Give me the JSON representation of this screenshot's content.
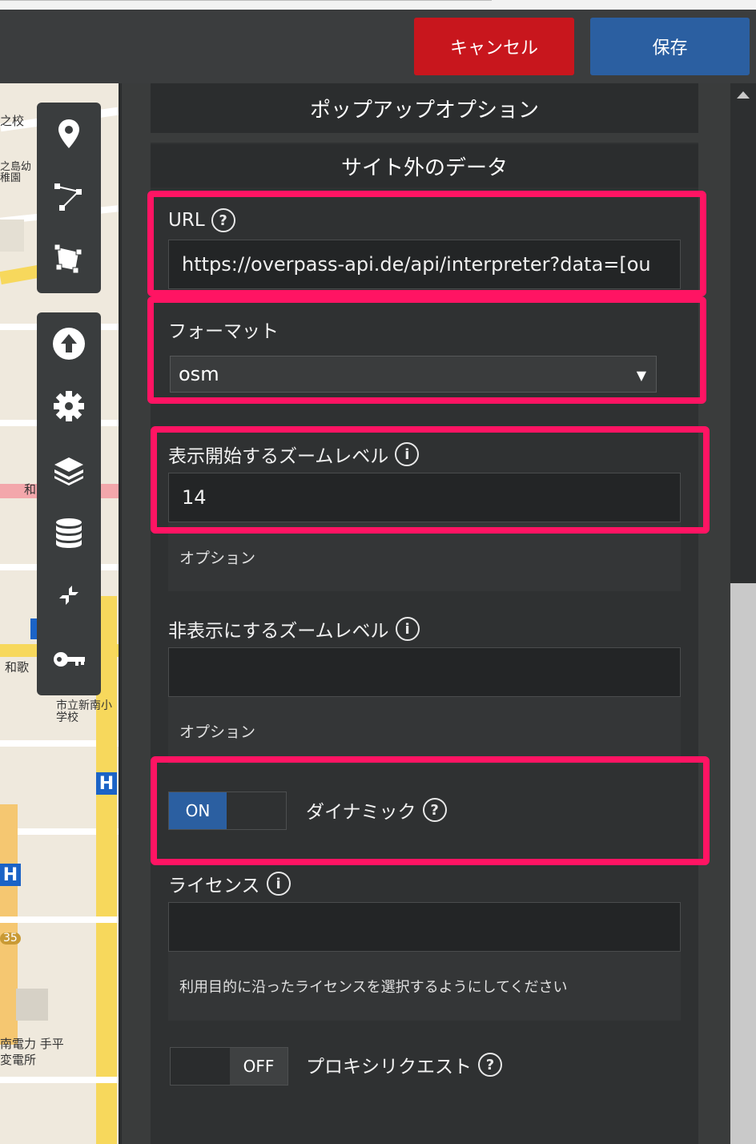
{
  "header": {
    "cancel_label": "キャンセル",
    "save_label": "保存"
  },
  "map": {
    "labels": [
      "之校",
      "之島幼稚園",
      "和",
      "和歌",
      "市立新南小学校",
      "35",
      "南電力 手平",
      "変電所"
    ],
    "hospital_marker": "H"
  },
  "panel": {
    "popup_options_title": "ポップアップオプション",
    "external_data_title": "サイト外のデータ",
    "url": {
      "label": "URL",
      "value": "https://overpass-api.de/api/interpreter?data=[ou"
    },
    "format": {
      "label": "フォーマット",
      "selected": "osm"
    },
    "zoom_start": {
      "label": "表示開始するズームレベル",
      "value": "14",
      "help": "オプション"
    },
    "zoom_hide": {
      "label": "非表示にするズームレベル",
      "value": "",
      "help": "オプション"
    },
    "dynamic": {
      "label": "ダイナミック",
      "state": "ON"
    },
    "license": {
      "label": "ライセンス",
      "value": "",
      "help": "利用目的に沿ったライセンスを選択するようにしてください"
    },
    "proxy": {
      "label": "プロキシリクエスト",
      "state": "OFF"
    }
  },
  "colors": {
    "cancel": "#c8161d",
    "save": "#2b5fa1",
    "highlight": "#ff1463",
    "toggle_on": "#2b5fa1"
  }
}
